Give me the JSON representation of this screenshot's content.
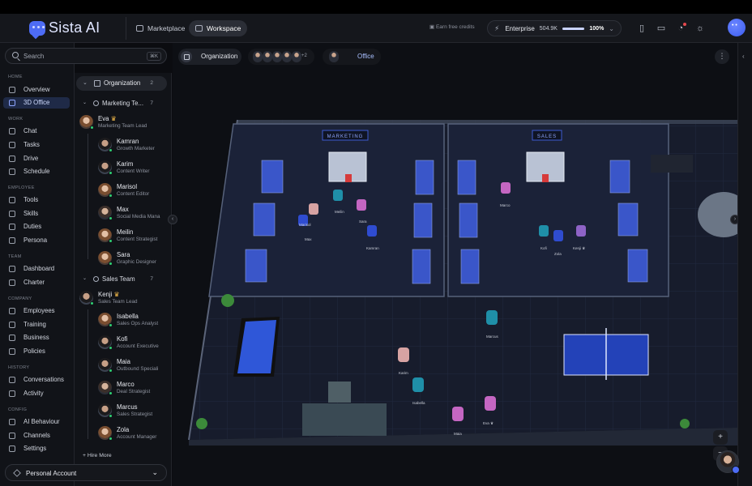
{
  "app": {
    "name": "Sista AI"
  },
  "header": {
    "tabs": [
      {
        "label": "Marketplace"
      },
      {
        "label": "Workspace"
      }
    ],
    "earn": "Earn free credits",
    "plan": {
      "name": "Enterprise",
      "credits": "504.9K",
      "usage_percent": "100%",
      "usage_fraction": 1.0
    },
    "icons": [
      "book-icon",
      "feedback-icon",
      "bell-icon",
      "sun-icon"
    ]
  },
  "sidebar": {
    "search": {
      "placeholder": "Search",
      "shortcut": "⌘K"
    },
    "sections": [
      {
        "title": "HOME",
        "items": [
          "Overview",
          "3D Office"
        ]
      },
      {
        "title": "WORK",
        "items": [
          "Chat",
          "Tasks",
          "Drive",
          "Schedule"
        ]
      },
      {
        "title": "EMPLOYEE",
        "items": [
          "Tools",
          "Skills",
          "Duties",
          "Persona"
        ]
      },
      {
        "title": "TEAM",
        "items": [
          "Dashboard",
          "Charter"
        ]
      },
      {
        "title": "COMPANY",
        "items": [
          "Employees",
          "Training",
          "Business",
          "Policies"
        ]
      },
      {
        "title": "HISTORY",
        "items": [
          "Conversations",
          "Activity"
        ]
      },
      {
        "title": "CONFIG",
        "items": [
          "AI Behaviour",
          "Channels",
          "Settings"
        ]
      }
    ],
    "active_item": "3D Office",
    "account": "Personal Account"
  },
  "org_tree": {
    "root": {
      "label": "Organization",
      "count": "2"
    },
    "teams": [
      {
        "label": "Marketing Te...",
        "count": "7",
        "lead": {
          "name": "Eva",
          "crown": "♛",
          "role": "Marketing Team Lead"
        },
        "members": [
          {
            "name": "Kamran",
            "role": "Growth Marketer"
          },
          {
            "name": "Karim",
            "role": "Content Writer"
          },
          {
            "name": "Marisol",
            "role": "Content Editor"
          },
          {
            "name": "Max",
            "role": "Social Media Mana"
          },
          {
            "name": "Meilin",
            "role": "Content Strategist"
          },
          {
            "name": "Sara",
            "role": "Graphic Designer"
          }
        ]
      },
      {
        "label": "Sales Team",
        "count": "7",
        "lead": {
          "name": "Kenji",
          "crown": "♛",
          "role": "Sales Team Lead"
        },
        "members": [
          {
            "name": "Isabella",
            "role": "Sales Ops Analyst"
          },
          {
            "name": "Kofi",
            "role": "Account Executive"
          },
          {
            "name": "Maia",
            "role": "Outbound Speciali"
          },
          {
            "name": "Marco",
            "role": "Deal Strategist"
          },
          {
            "name": "Marcus",
            "role": "Sales Strategist"
          },
          {
            "name": "Zola",
            "role": "Account Manager"
          }
        ]
      }
    ],
    "hire_more": "+  Hire More"
  },
  "breadcrumb": {
    "org": "Organization",
    "extra_count": "+2",
    "office": "Office"
  },
  "office": {
    "rooms": [
      "MARKETING",
      "SALES"
    ],
    "agent_labels": [
      "Max",
      "Marisol",
      "Meilin",
      "Sara",
      "Kamran",
      "Marco",
      "Kofi",
      "Zola",
      "Kenji ♛",
      "Marcus",
      "Karim",
      "Isabella",
      "Maia",
      "Eva ♛"
    ]
  },
  "controls": {
    "zoom_in": "+",
    "zoom_out": "−"
  }
}
